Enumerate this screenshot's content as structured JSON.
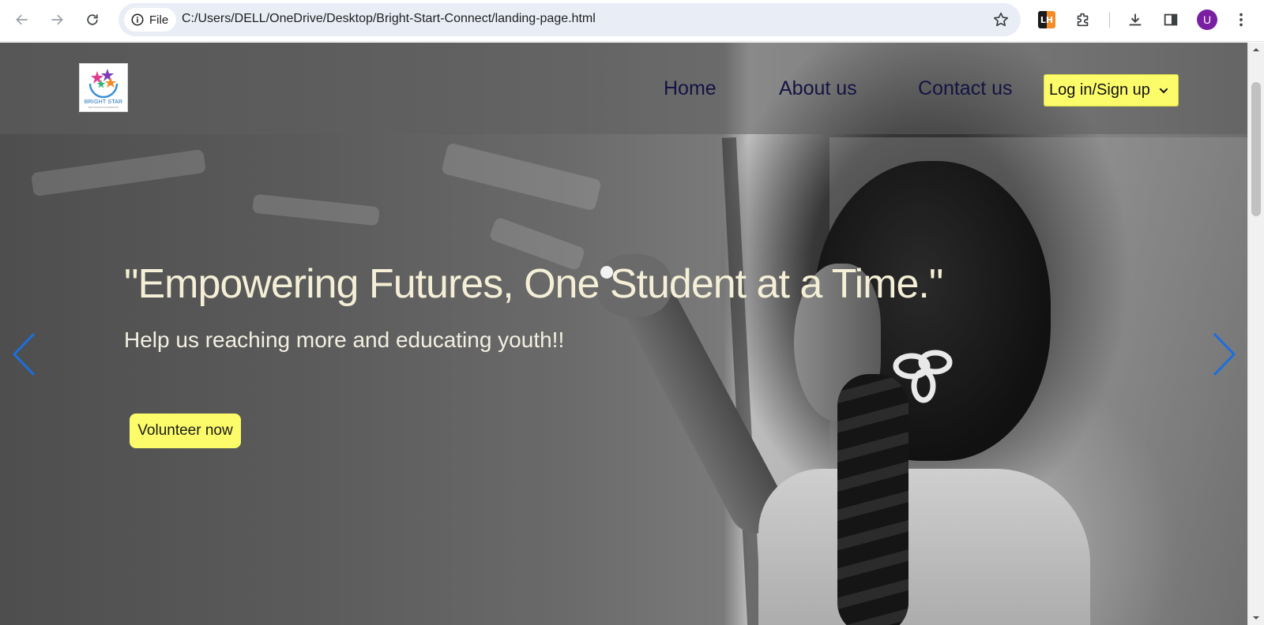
{
  "browser": {
    "site_chip_label": "File",
    "url": "C:/Users/DELL/OneDrive/Desktop/Bright-Start-Connect/landing-page.html",
    "extension_badge": "LH",
    "profile_initial": "U",
    "icons": [
      "back-icon",
      "forward-icon",
      "reload-icon",
      "info-icon",
      "star-icon",
      "extensions-icon",
      "download-icon",
      "side-panel-icon",
      "more-icon"
    ]
  },
  "header": {
    "logo": {
      "text": "BRIGHT STAR",
      "subtext": "EDUCATION FOUNDATION"
    },
    "nav": [
      {
        "label": "Home"
      },
      {
        "label": "About us"
      },
      {
        "label": "Contact us"
      }
    ],
    "login_label": "Log in/Sign up"
  },
  "hero": {
    "title": "\"Empowering Futures, One Student at a Time.\"",
    "subtitle": "Help us reaching more and educating youth!!",
    "cta_label": "Volunteer now"
  },
  "colors": {
    "accent_yellow": "#fcfc6a",
    "nav_text": "#131344",
    "arrow_blue": "#1a6fe0",
    "hero_text": "#f4efd6"
  }
}
